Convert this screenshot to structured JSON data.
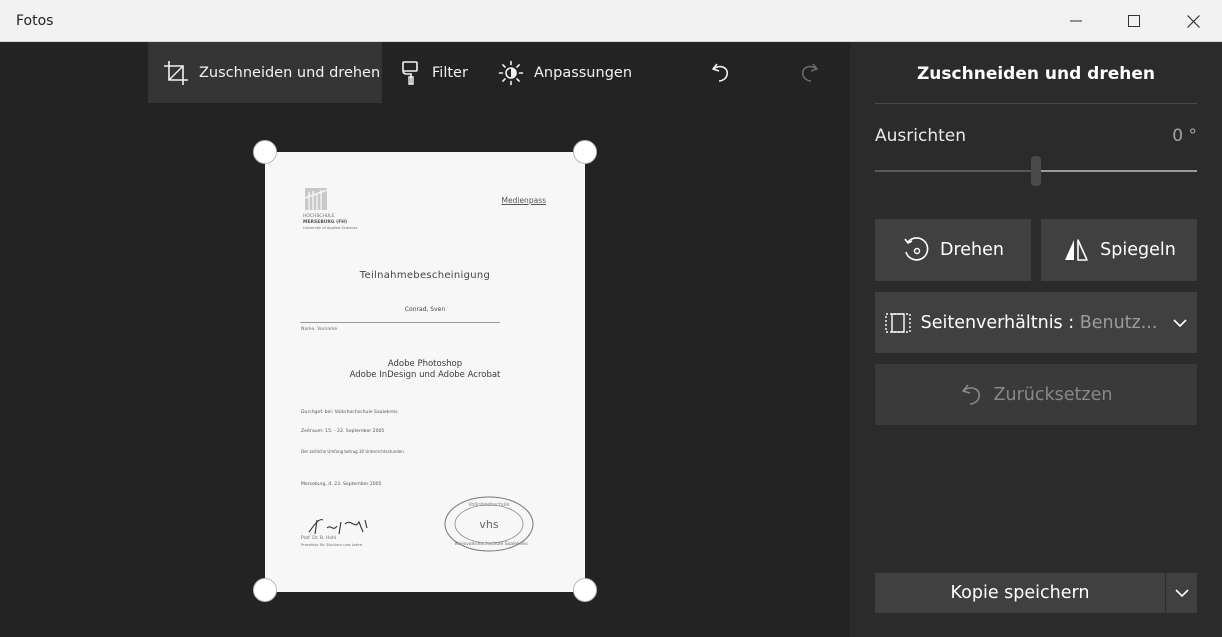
{
  "window": {
    "title": "Fotos"
  },
  "toolbar": {
    "crop_label": "Zuschneiden und drehen",
    "filter_label": "Filter",
    "adjust_label": "Anpassungen"
  },
  "document": {
    "medienpass": "Medienpass",
    "logo_line1": "HOCHSCHULE",
    "logo_line2": "MERSEBURG (FH)",
    "logo_line3": "University of Applied Sciences",
    "heading": "Teilnahmebescheinigung",
    "name": "Conrad, Sven",
    "name_sub": "Name, Vorname",
    "course_line1": "Adobe Photoshop",
    "course_line2": "Adobe InDesign und Adobe Acrobat",
    "field1": "Durchgef. bei:    Volkshochschule Saalekreis",
    "field2": "Zeitraum:          15. - 22. September 2005",
    "field3": "Der zeitliche Umfang betrug 30 Unterrichtsstunden.",
    "place_date": "Merseburg, d. 23. September 2005",
    "signer1": "Prof. Dr. B. Hohl",
    "signer1_title": "Prorektor für Studium und Lehre",
    "stamp_text": "vhs",
    "stamp_ring": "Volkshochschule",
    "signer2": "Kreisvolkshochschule Saalekreis"
  },
  "panel": {
    "title": "Zuschneiden und drehen",
    "straighten_label": "Ausrichten",
    "straighten_value": "0 °",
    "straighten_level": 0.5,
    "rotate_label": "Drehen",
    "flip_label": "Spiegeln",
    "aspect_label": "Seitenverhältnis : ",
    "aspect_value": "Benutz...",
    "reset_label": "Zurücksetzen",
    "save_label": "Kopie speichern"
  }
}
